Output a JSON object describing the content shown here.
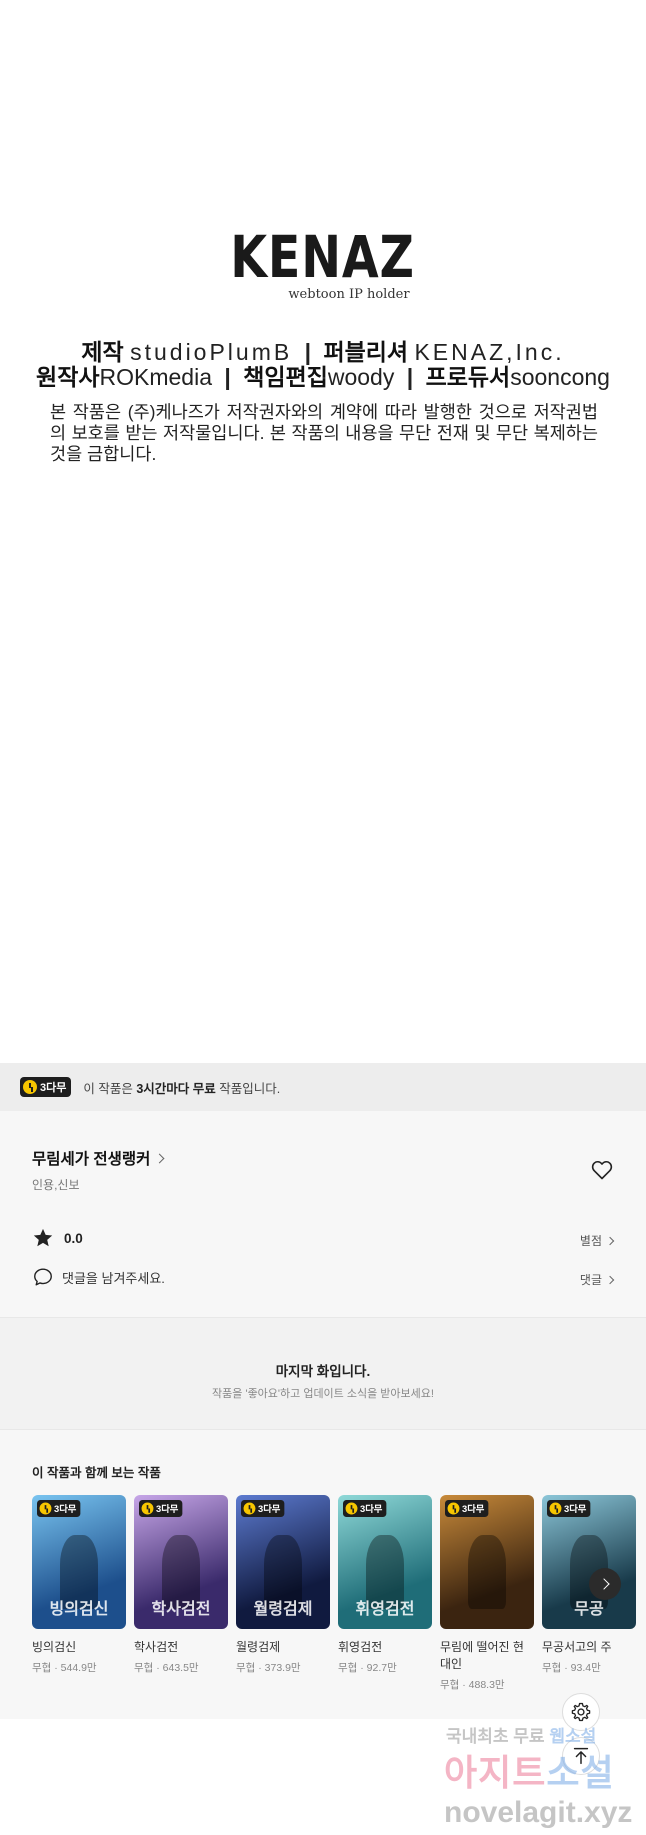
{
  "credits": {
    "logo_word": "KENAZ",
    "logo_sub": "webtoon IP holder",
    "line1": [
      {
        "label": "제작",
        "value": "studioPlumB"
      },
      {
        "label": "퍼블리셔",
        "value": "KENAZ,Inc."
      }
    ],
    "line2": [
      {
        "label": "원작사",
        "value": "ROKmedia"
      },
      {
        "label": "책임편집",
        "value": "woody"
      },
      {
        "label": "프로듀서",
        "value": "sooncong"
      }
    ],
    "separator": "|",
    "notice": "본 작품은 (주)케나즈가 저작권자와의 계약에 따라 발행한 것으로 저작권법의 보호를 받는 저작물입니다. 본 작품의 내용을 무단 전재 및 무단 복제하는 것을 금합니다."
  },
  "banner": {
    "badge": "3다무",
    "text_pre": "이 작품은 ",
    "text_bold": "3시간마다 무료",
    "text_post": " 작품입니다."
  },
  "info": {
    "title": "무림세가 전생랭커",
    "authors": "인용,신보",
    "rating": "0.0",
    "rate_link": "별점",
    "comment_prompt": "댓글을 남겨주세요.",
    "comment_link": "댓글"
  },
  "last_chapter": {
    "title": "마지막 화입니다.",
    "subtitle": "작품을 '좋아요'하고 업데이트 소식을 받아보세요!"
  },
  "recommendations": {
    "title": "이 작품과 함께 보는 작품",
    "items": [
      {
        "name": "빙의검신",
        "meta": "무협 · 544.9만",
        "badge": "3다무",
        "art": "빙의검신",
        "color_a": "#1d4f8c",
        "color_b": "#79c4f0"
      },
      {
        "name": "학사검전",
        "meta": "무협 · 643.5만",
        "badge": "3다무",
        "art": "학사검전",
        "color_a": "#3a2a6b",
        "color_b": "#c7a6e8"
      },
      {
        "name": "월령검제",
        "meta": "무협 · 373.9만",
        "badge": "3다무",
        "art": "월령검제",
        "color_a": "#101a3f",
        "color_b": "#5d7bd0"
      },
      {
        "name": "휘영검전",
        "meta": "무협 · 92.7만",
        "badge": "3다무",
        "art": "휘영검전",
        "color_a": "#1f6d78",
        "color_b": "#8fd9d8"
      },
      {
        "name": "무림에 떨어진 현대인",
        "meta": "무협 · 488.3만",
        "badge": "3다무",
        "art": "",
        "color_a": "#3b2410",
        "color_b": "#c88a3a"
      },
      {
        "name": "무공서고의 주",
        "meta": "무협 · 93.4만",
        "badge": "3다무",
        "art": "무공",
        "color_a": "#183a4a",
        "color_b": "#8cc6d8"
      }
    ]
  },
  "watermark": {
    "line1_a": "국내최초 무료",
    "line1_b": "웹소설",
    "line2_a": "아지트",
    "line2_b": "소설",
    "line3": "novelagit.xyz"
  }
}
